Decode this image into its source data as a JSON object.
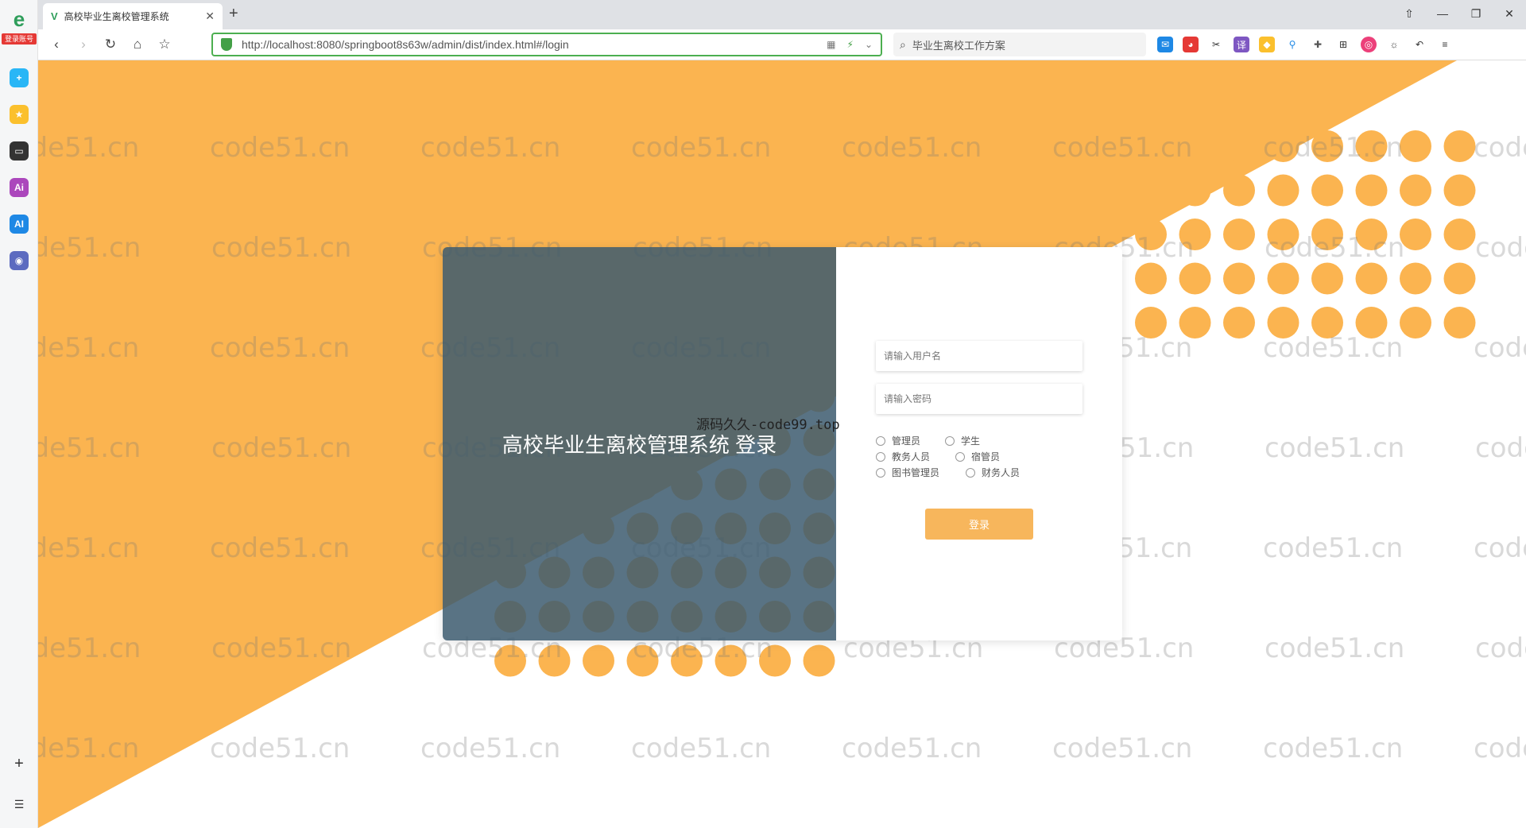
{
  "browser": {
    "tab_title": "高校毕业生离校管理系统",
    "url": "http://localhost:8080/springboot8s63w/admin/dist/index.html#/login",
    "search_text": "毕业生离校工作方案",
    "sidebar_badge": "登录账号"
  },
  "colors": {
    "accent_orange": "#fbb450",
    "panel_slate": "#4f6d82",
    "button_orange": "#f7b65c"
  },
  "watermark": "code51.cn",
  "overlay_text": "源码久久-code99.top",
  "login": {
    "title": "高校毕业生离校管理系统 登录",
    "username_placeholder": "请输入用户名",
    "password_placeholder": "请输入密码",
    "roles": [
      "管理员",
      "学生",
      "教务人员",
      "宿管员",
      "图书管理员",
      "财务人员"
    ],
    "submit_label": "登录"
  }
}
